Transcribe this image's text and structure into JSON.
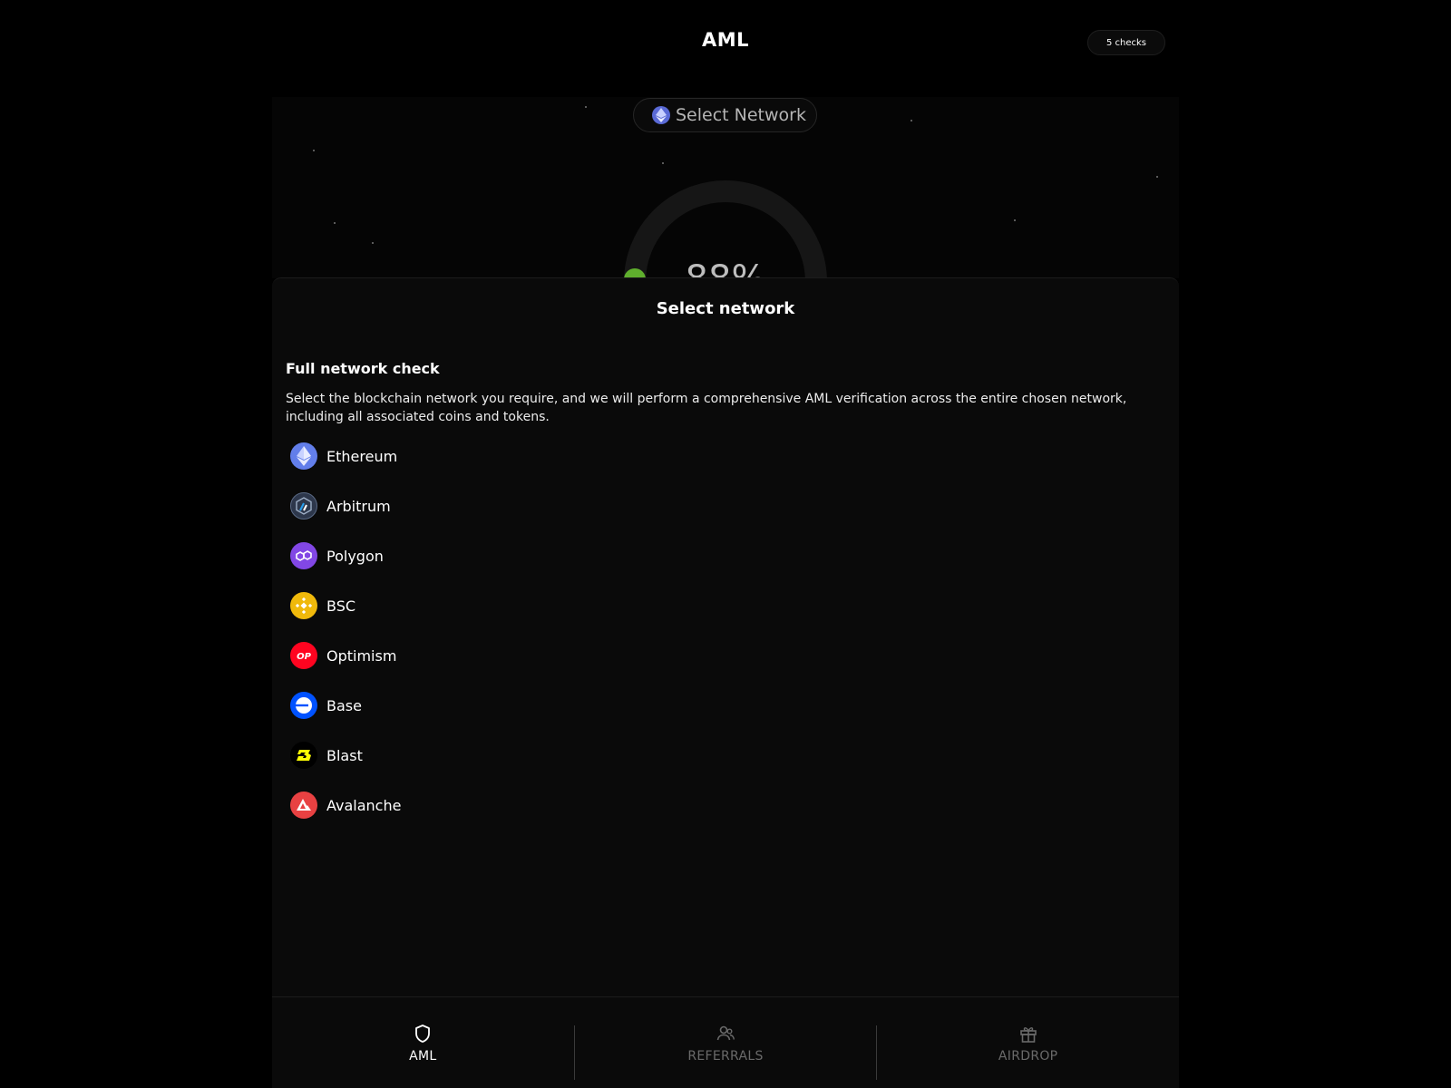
{
  "header": {
    "title": "AML",
    "checks_badge": "5 checks"
  },
  "hero": {
    "select_network_label": "Select Network",
    "score_value": "88%"
  },
  "sheet": {
    "title": "Select network",
    "section_heading": "Full network check",
    "description": "Select the blockchain network you require, and we will perform a comprehensive AML verification across the entire chosen network, including all associated coins and tokens.",
    "networks": [
      {
        "label": "Ethereum",
        "icon": "ethereum-icon",
        "color": "#627EEA"
      },
      {
        "label": "Arbitrum",
        "icon": "arbitrum-icon",
        "color": "#2D374B"
      },
      {
        "label": "Polygon",
        "icon": "polygon-icon",
        "color": "#8247E5"
      },
      {
        "label": "BSC",
        "icon": "bsc-icon",
        "color": "#F0B90B"
      },
      {
        "label": "Optimism",
        "icon": "optimism-icon",
        "color": "#FF0420"
      },
      {
        "label": "Base",
        "icon": "base-icon",
        "color": "#0052FF"
      },
      {
        "label": "Blast",
        "icon": "blast-icon",
        "color": "#000000"
      },
      {
        "label": "Avalanche",
        "icon": "avalanche-icon",
        "color": "#E84142"
      }
    ]
  },
  "nav": {
    "tabs": [
      {
        "label": "AML",
        "icon": "shield-icon",
        "active": true
      },
      {
        "label": "REFERRALS",
        "icon": "users-icon",
        "active": false
      },
      {
        "label": "AIRDROP",
        "icon": "gift-icon",
        "active": false
      }
    ]
  },
  "colors": {
    "background": "#000000",
    "sheet": "#0A0A0A",
    "gauge_accent": "#5FAE2D",
    "inactive_text": "#6A6A6A"
  }
}
